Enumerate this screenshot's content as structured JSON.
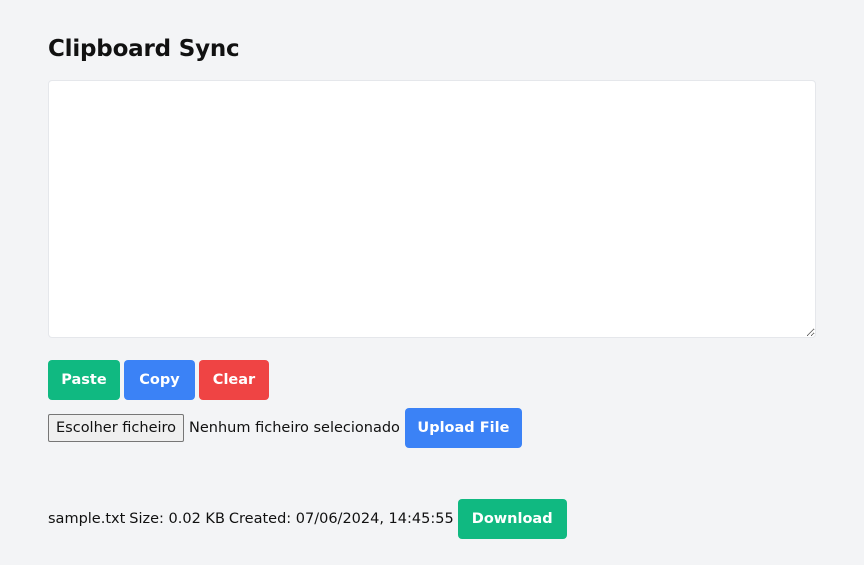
{
  "app": {
    "title": "Clipboard Sync"
  },
  "editor": {
    "value": "",
    "placeholder": ""
  },
  "actions": {
    "paste_label": "Paste",
    "copy_label": "Copy",
    "clear_label": "Clear"
  },
  "upload": {
    "choose_label": "Escolher ficheiro",
    "status_text": "Nenhum ficheiro selecionado",
    "upload_label": "Upload File"
  },
  "files": [
    {
      "name": "sample.txt",
      "size_text": "Size: 0.02 KB",
      "created_text": "Created: 07/06/2024, 14:45:55",
      "download_label": "Download"
    }
  ],
  "colors": {
    "background": "#f3f4f6",
    "green": "#10b981",
    "blue": "#3b82f6",
    "red": "#ef4444"
  }
}
